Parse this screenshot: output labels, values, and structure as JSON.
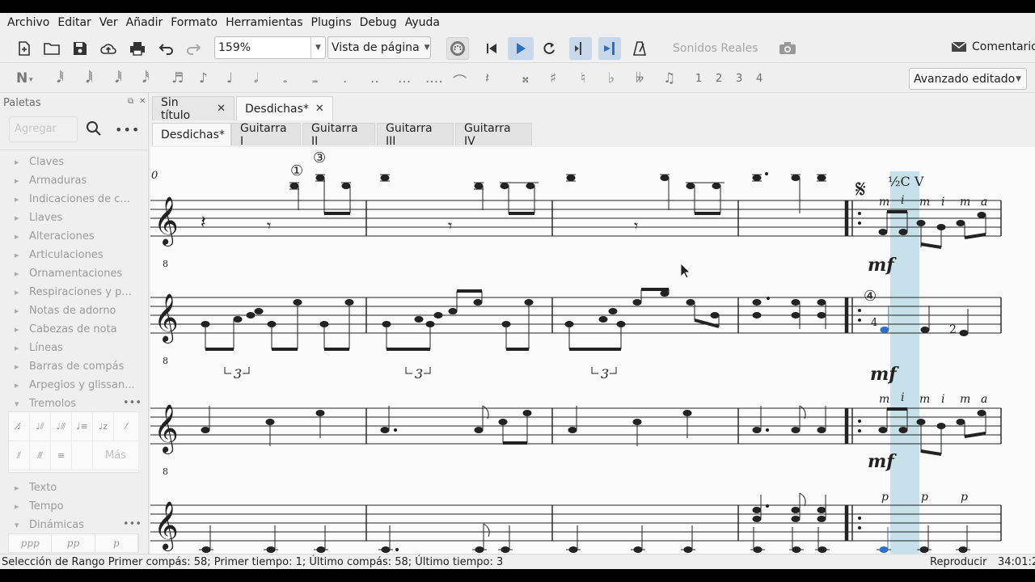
{
  "menu": [
    "Archivo",
    "Editar",
    "Ver",
    "Añadir",
    "Formato",
    "Herramientas",
    "Plugins",
    "Debug",
    "Ayuda"
  ],
  "toolbar": {
    "zoom": "159%",
    "view_mode": "Vista de página",
    "real_sounds": "Sonidos Reales",
    "comments": "Comentario"
  },
  "notebar": {
    "voices": [
      "1",
      "2",
      "3",
      "4"
    ],
    "workspace": "Avanzado editado"
  },
  "palettes": {
    "title": "Palettes_placeholder",
    "heading": "Paletas",
    "search_placeholder": "Agregar",
    "items": [
      "Claves",
      "Armaduras",
      "Indicaciones de c...",
      "Llaves",
      "Alteraciones",
      "Articulaciones",
      "Ornamentaciones",
      "Respiraciones y p...",
      "Notas de adorno",
      "Cabezas de nota",
      "Líneas",
      "Barras de compás",
      "Arpegios y glissan...",
      "Tremolos"
    ],
    "more_label": "Más",
    "items_after": [
      "Texto",
      "Tempo",
      "Dinámicas"
    ],
    "dynamics": [
      "ppp",
      "pp",
      "p"
    ]
  },
  "doc_tabs": [
    {
      "label": "Sin título"
    },
    {
      "label": "Desdichas*"
    }
  ],
  "part_tabs": [
    "Desdichas*",
    "Guitarra I",
    "Guitarra II",
    "Guitarra III",
    "Guitarra IV"
  ],
  "score": {
    "measure_number": "0",
    "string_1": "①",
    "string_3": "③",
    "string_4": "④",
    "barre": "½C V",
    "fingering_top": [
      "m",
      "i",
      "m",
      "i",
      "m",
      "a"
    ],
    "fingering_bass": [
      "p",
      "p",
      "p"
    ],
    "dynamic": "mf",
    "tuplet": "3",
    "finger_4": "4",
    "finger_2": "2",
    "clef_octave": "8"
  },
  "status": {
    "selection": "Selección de Rango Primer compás: 58; Primer tiempo: 1; Último compás: 58; Último tiempo: 3",
    "mode": "Reproducir",
    "time": "34:01:2"
  }
}
